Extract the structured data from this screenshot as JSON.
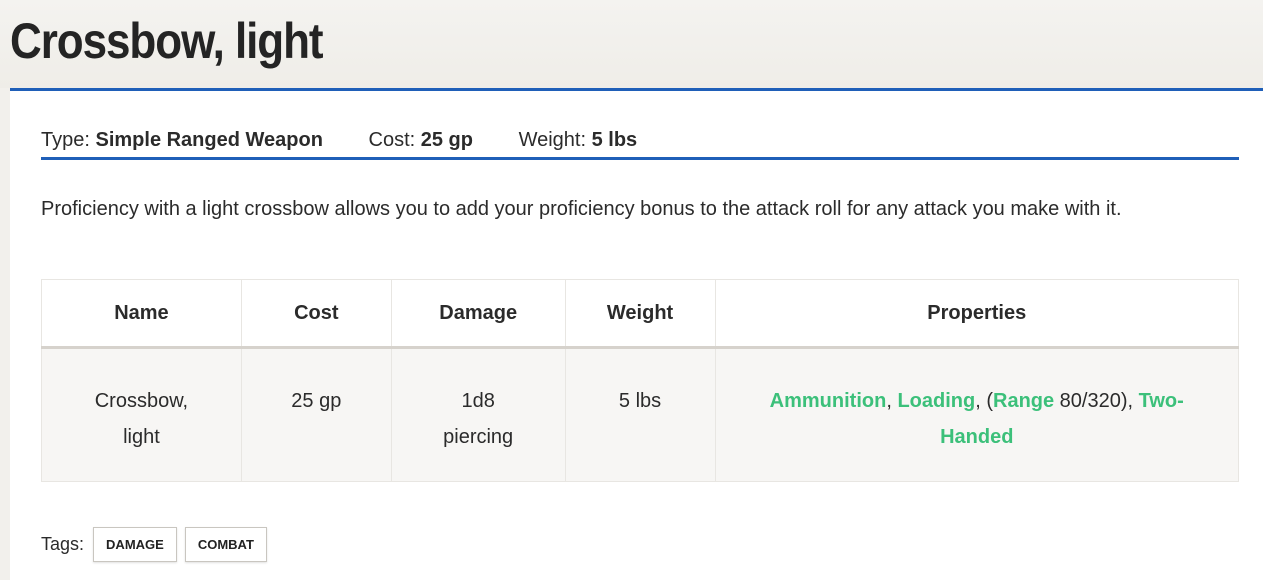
{
  "page": {
    "title": "Crossbow, light"
  },
  "meta": {
    "type_label": "Type:",
    "type_value": "Simple Ranged Weapon",
    "cost_label": "Cost:",
    "cost_value": "25 gp",
    "weight_label": "Weight:",
    "weight_value": "5 lbs"
  },
  "description": "Proficiency with a light crossbow allows you to add your proficiency bonus to the attack roll for any attack you make with it.",
  "table": {
    "headers": [
      "Name",
      "Cost",
      "Damage",
      "Weight",
      "Properties"
    ],
    "row": {
      "name_line1": "Crossbow,",
      "name_line2": "light",
      "cost": "25 gp",
      "damage_line1": "1d8",
      "damage_line2": "piercing",
      "weight": "5 lbs",
      "properties": {
        "ammunition": "Ammunition",
        "sep1": ",",
        "loading": "Loading",
        "sep2": ", (",
        "range": "Range",
        "range_value": " 80/320),",
        "two_handed_1": "Two-",
        "two_handed_2": "Handed"
      }
    }
  },
  "tags": {
    "label": "Tags:",
    "items": [
      "DAMAGE",
      "COMBAT"
    ]
  },
  "colors": {
    "accent_blue": "#1f5fb8",
    "link_green": "#3cc07a"
  }
}
